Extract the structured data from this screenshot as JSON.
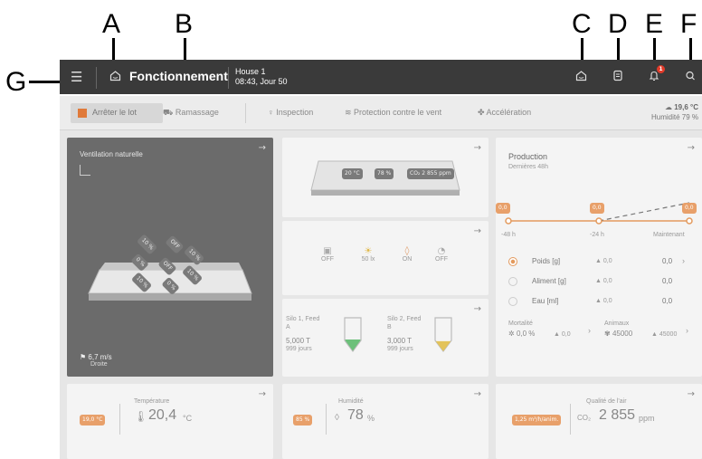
{
  "callouts": {
    "a": "A",
    "b": "B",
    "c": "C",
    "d": "D",
    "e": "E",
    "f": "F",
    "g": "G"
  },
  "topbar": {
    "menu_icon": "hamburger-icon",
    "title": "Fonctionnement",
    "house_name": "House 1",
    "house_time": "08:43, Jour 50",
    "notification_count": "1",
    "icons": [
      "home-icon",
      "house-status-icon",
      "report-icon",
      "bell-icon",
      "search-icon"
    ]
  },
  "subbar": {
    "stop_label": "Arrêter le lot",
    "pickup_label": "Ramassage",
    "inspection_label": "Inspection",
    "wind_label": "Protection contre le vent",
    "accel_label": "Accélération",
    "outside_temp": "19,6 °C",
    "outside_humidity": "Humidité 79 %"
  },
  "ventilation": {
    "title": "Ventilation naturelle",
    "flap_labels": [
      "10 %",
      "OFF",
      "0 %",
      "OFF",
      "10 %",
      "10 %",
      "0 %",
      "10 %"
    ],
    "wind_speed": "6,7 m/s",
    "wind_dir": "Droite"
  },
  "house_card": {
    "temp": "20 °C",
    "humidity": "78 %",
    "co2": "CO₂ 2 855 ppm"
  },
  "devices": {
    "items": [
      {
        "icon": "heater-icon",
        "value": "OFF"
      },
      {
        "icon": "light-icon",
        "value": "50 lx"
      },
      {
        "icon": "water-icon",
        "value": "ON"
      },
      {
        "icon": "feed-icon",
        "value": "OFF"
      }
    ]
  },
  "silos": [
    {
      "name": "Silo 1, Feed A",
      "amount": "5,000 T",
      "days": "999 jours",
      "fill_color": "#6cc07a",
      "fill": 0.35
    },
    {
      "name": "Silo 2, Feed B",
      "amount": "3,000 T",
      "days": "999 jours",
      "fill_color": "#e3c35a",
      "fill": 0.3
    }
  ],
  "production": {
    "title": "Production",
    "subtitle": "Dernières 48h",
    "markers": [
      "0,0",
      "0,0",
      "0,0"
    ],
    "axis_labels": [
      "-48 h",
      "-24 h",
      "Maintenant"
    ],
    "rows": [
      {
        "label": "Poids [g]",
        "delta": "▲ 0,0",
        "value": "0,0",
        "selected": true
      },
      {
        "label": "Aliment [g]",
        "delta": "▲ 0,0",
        "value": "0,0",
        "selected": false
      },
      {
        "label": "Eau [ml]",
        "delta": "▲ 0,0",
        "value": "0,0",
        "selected": false
      }
    ],
    "mortality_label": "Mortalité",
    "mortality_value": "0,0 %",
    "mortality_delta": "▲ 0,0",
    "animals_label": "Animaux",
    "animals_value": "45000",
    "animals_delta": "▲ 45000"
  },
  "bottom": {
    "temp_title": "Température",
    "temp_setpoint": "19,0 °C",
    "temp_value": "20,4",
    "temp_unit": "°C",
    "hum_title": "Humidité",
    "hum_setpoint": "85 %",
    "hum_value": "78",
    "hum_unit": "%",
    "air_title": "Qualité de l'air",
    "air_setpoint": "1,25 m³/h/anim.",
    "air_co2": "CO₂",
    "air_value": "2 855",
    "air_unit": "ppm"
  }
}
